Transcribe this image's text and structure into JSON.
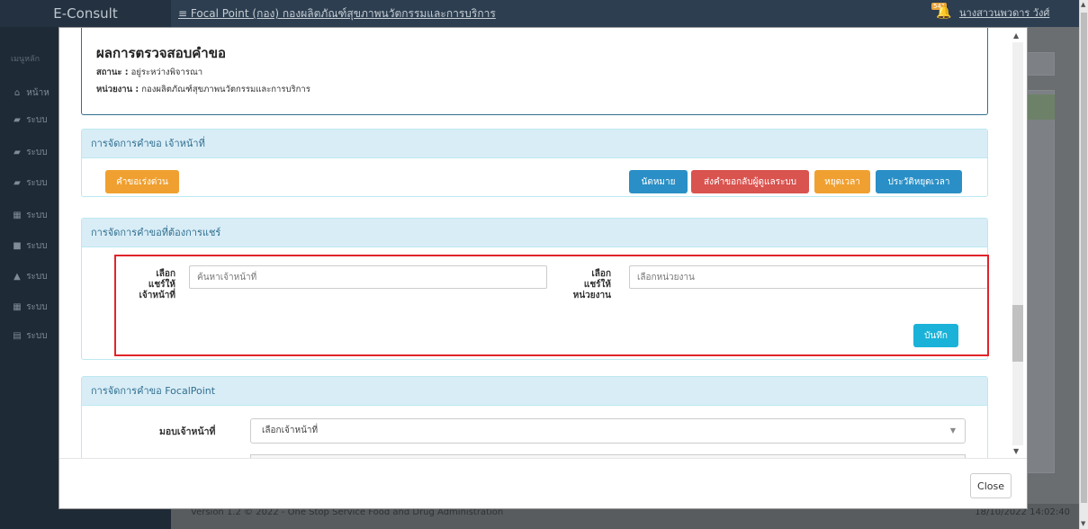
{
  "app": {
    "brand": "E-Consult",
    "title": "≡  Focal Point (กอง) กองผลิตภัณฑ์สุขภาพนวัตกรรมและการบริการ",
    "notif_count": "541",
    "user": "นางสาวนพวดาร วังศ์",
    "sidebar_caption": "เมนูหลัก",
    "sidebar_items": [
      "หน้าห",
      "ระบบ",
      "ระบบ",
      "ระบบ",
      "ระบบ",
      "ระบบ",
      "ระบบ",
      "ระบบ",
      "ระบบ"
    ],
    "footer_version": "Version 1.2 © 2022 - One Stop Service Food and Drug Administration",
    "footer_time": "18/10/2022 14:02:40"
  },
  "summary": {
    "title": "ผลการตรวจสอบคำขอ",
    "status_label": "สถานะ :",
    "status_value": "อยู่ระหว่างพิจารณา",
    "unit_label": "หน่วยงาน :",
    "unit_value": "กองผลิตภัณฑ์สุขภาพนวัตกรรมและการบริการ"
  },
  "officer_panel": {
    "heading": "การจัดการคำขอ เจ้าหน้าที่",
    "urgent_label": "คำขอเร่งด่วน",
    "appointment_label": "นัดหมาย",
    "send_back_label": "ส่งคำขอกลับผู้ดูแลระบบ",
    "pause_label": "หยุดเวลา",
    "pause_history_label": "ประวัติหยุดเวลา"
  },
  "share_panel": {
    "heading": "การจัดการคำขอที่ต้องการแชร์",
    "officer_label_1": "เลือก",
    "officer_label_2": "แชร์ให้",
    "officer_label_3": "เจ้าหน้าที่",
    "officer_placeholder": "ค้นหาเจ้าหน้าที่",
    "unit_label_1": "เลือก",
    "unit_label_2": "แชร์ให้",
    "unit_label_3": "หน่วยงาน",
    "unit_placeholder": "เลือกหน่วยงาน",
    "save_label": "บันทึก"
  },
  "focal_panel": {
    "heading": "การจัดการคำขอ FocalPoint",
    "assign_label": "มอบเจ้าหน้าที่",
    "assign_value": "เลือกเจ้าหน้าที่"
  },
  "modal": {
    "close_label": "Close"
  },
  "colors": {
    "panel_heading_bg": "#d9edf7",
    "panel_heading_text": "#31708f",
    "orange": "#f0a030",
    "blue": "#2a8fc6",
    "red": "#d9534f",
    "cyan": "#1ab2d8",
    "highlight": "#e0242a"
  }
}
